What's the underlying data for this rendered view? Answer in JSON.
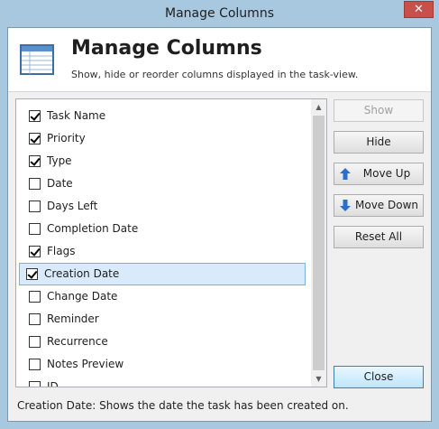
{
  "window": {
    "title": "Manage Columns",
    "close_glyph": "✕"
  },
  "header": {
    "title": "Manage Columns",
    "subtitle": "Show, hide or reorder columns displayed in the task-view.",
    "icon": "table-icon"
  },
  "columns": [
    {
      "label": "Task Name",
      "checked": true,
      "selected": false
    },
    {
      "label": "Priority",
      "checked": true,
      "selected": false
    },
    {
      "label": "Type",
      "checked": true,
      "selected": false
    },
    {
      "label": "Date",
      "checked": false,
      "selected": false
    },
    {
      "label": "Days Left",
      "checked": false,
      "selected": false
    },
    {
      "label": "Completion Date",
      "checked": false,
      "selected": false
    },
    {
      "label": "Flags",
      "checked": true,
      "selected": false
    },
    {
      "label": "Creation Date",
      "checked": true,
      "selected": true
    },
    {
      "label": "Change Date",
      "checked": false,
      "selected": false
    },
    {
      "label": "Reminder",
      "checked": false,
      "selected": false
    },
    {
      "label": "Recurrence",
      "checked": false,
      "selected": false
    },
    {
      "label": "Notes Preview",
      "checked": false,
      "selected": false
    },
    {
      "label": "ID",
      "checked": false,
      "selected": false
    }
  ],
  "buttons": {
    "show": "Show",
    "hide": "Hide",
    "move_up": "Move Up",
    "move_down": "Move Down",
    "reset_all": "Reset All",
    "close": "Close"
  },
  "status": "Creation Date: Shows the date the task has been created on.",
  "colors": {
    "selection_bg": "#d9ebfa",
    "selection_border": "#7db0df",
    "titlebar": "#a8c8e0",
    "arrow_blue": "#2a6fc9"
  }
}
